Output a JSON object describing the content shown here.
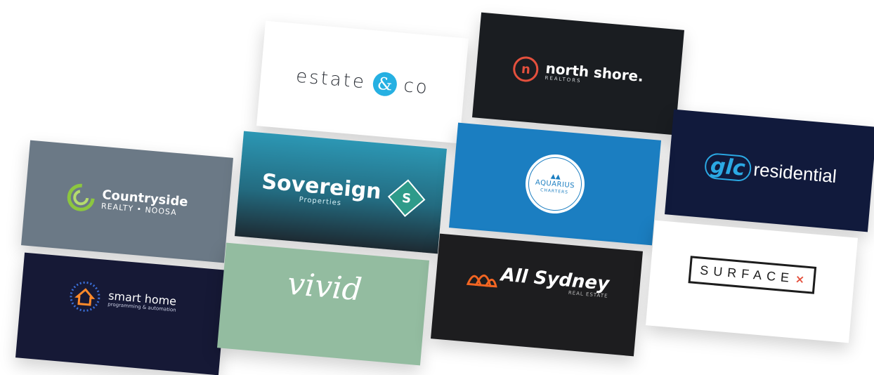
{
  "cards": {
    "estate": {
      "word": "estate",
      "amp": "&",
      "co": "co"
    },
    "north_shore": {
      "glyph": "n",
      "title": "north shore.",
      "subtitle": "REALTORS"
    },
    "glc": {
      "badge": "glc",
      "word": "residential"
    },
    "countryside": {
      "title": "Countryside",
      "sub_left": "REALTY",
      "sub_dot": "•",
      "sub_right": "NOOSA"
    },
    "sovereign": {
      "title": "Sovereign",
      "subtitle": "Properties",
      "glyph": "S"
    },
    "aquarius": {
      "peaks": "▲▲",
      "title": "AQUARIUS",
      "subtitle": "CHARTERS"
    },
    "smart_home": {
      "title": "smart home",
      "subtitle": "programming & automation"
    },
    "vivid": {
      "word": "vivid"
    },
    "all_sydney": {
      "title": "All Sydney",
      "subtitle": "REAL ESTATE"
    },
    "surface": {
      "word": "SURFACE",
      "mark": "×"
    }
  },
  "colors": {
    "estate_accent": "#26b0e2",
    "north_shore_accent": "#e4503d",
    "glc_accent": "#2ba9e4",
    "countryside_accent": "#8cc63f",
    "aquarius_bg": "#1b7ec1",
    "smart_home_accent": "#ff8a2a",
    "sydney_accent": "#f26522",
    "surface_accent": "#e4503d"
  }
}
